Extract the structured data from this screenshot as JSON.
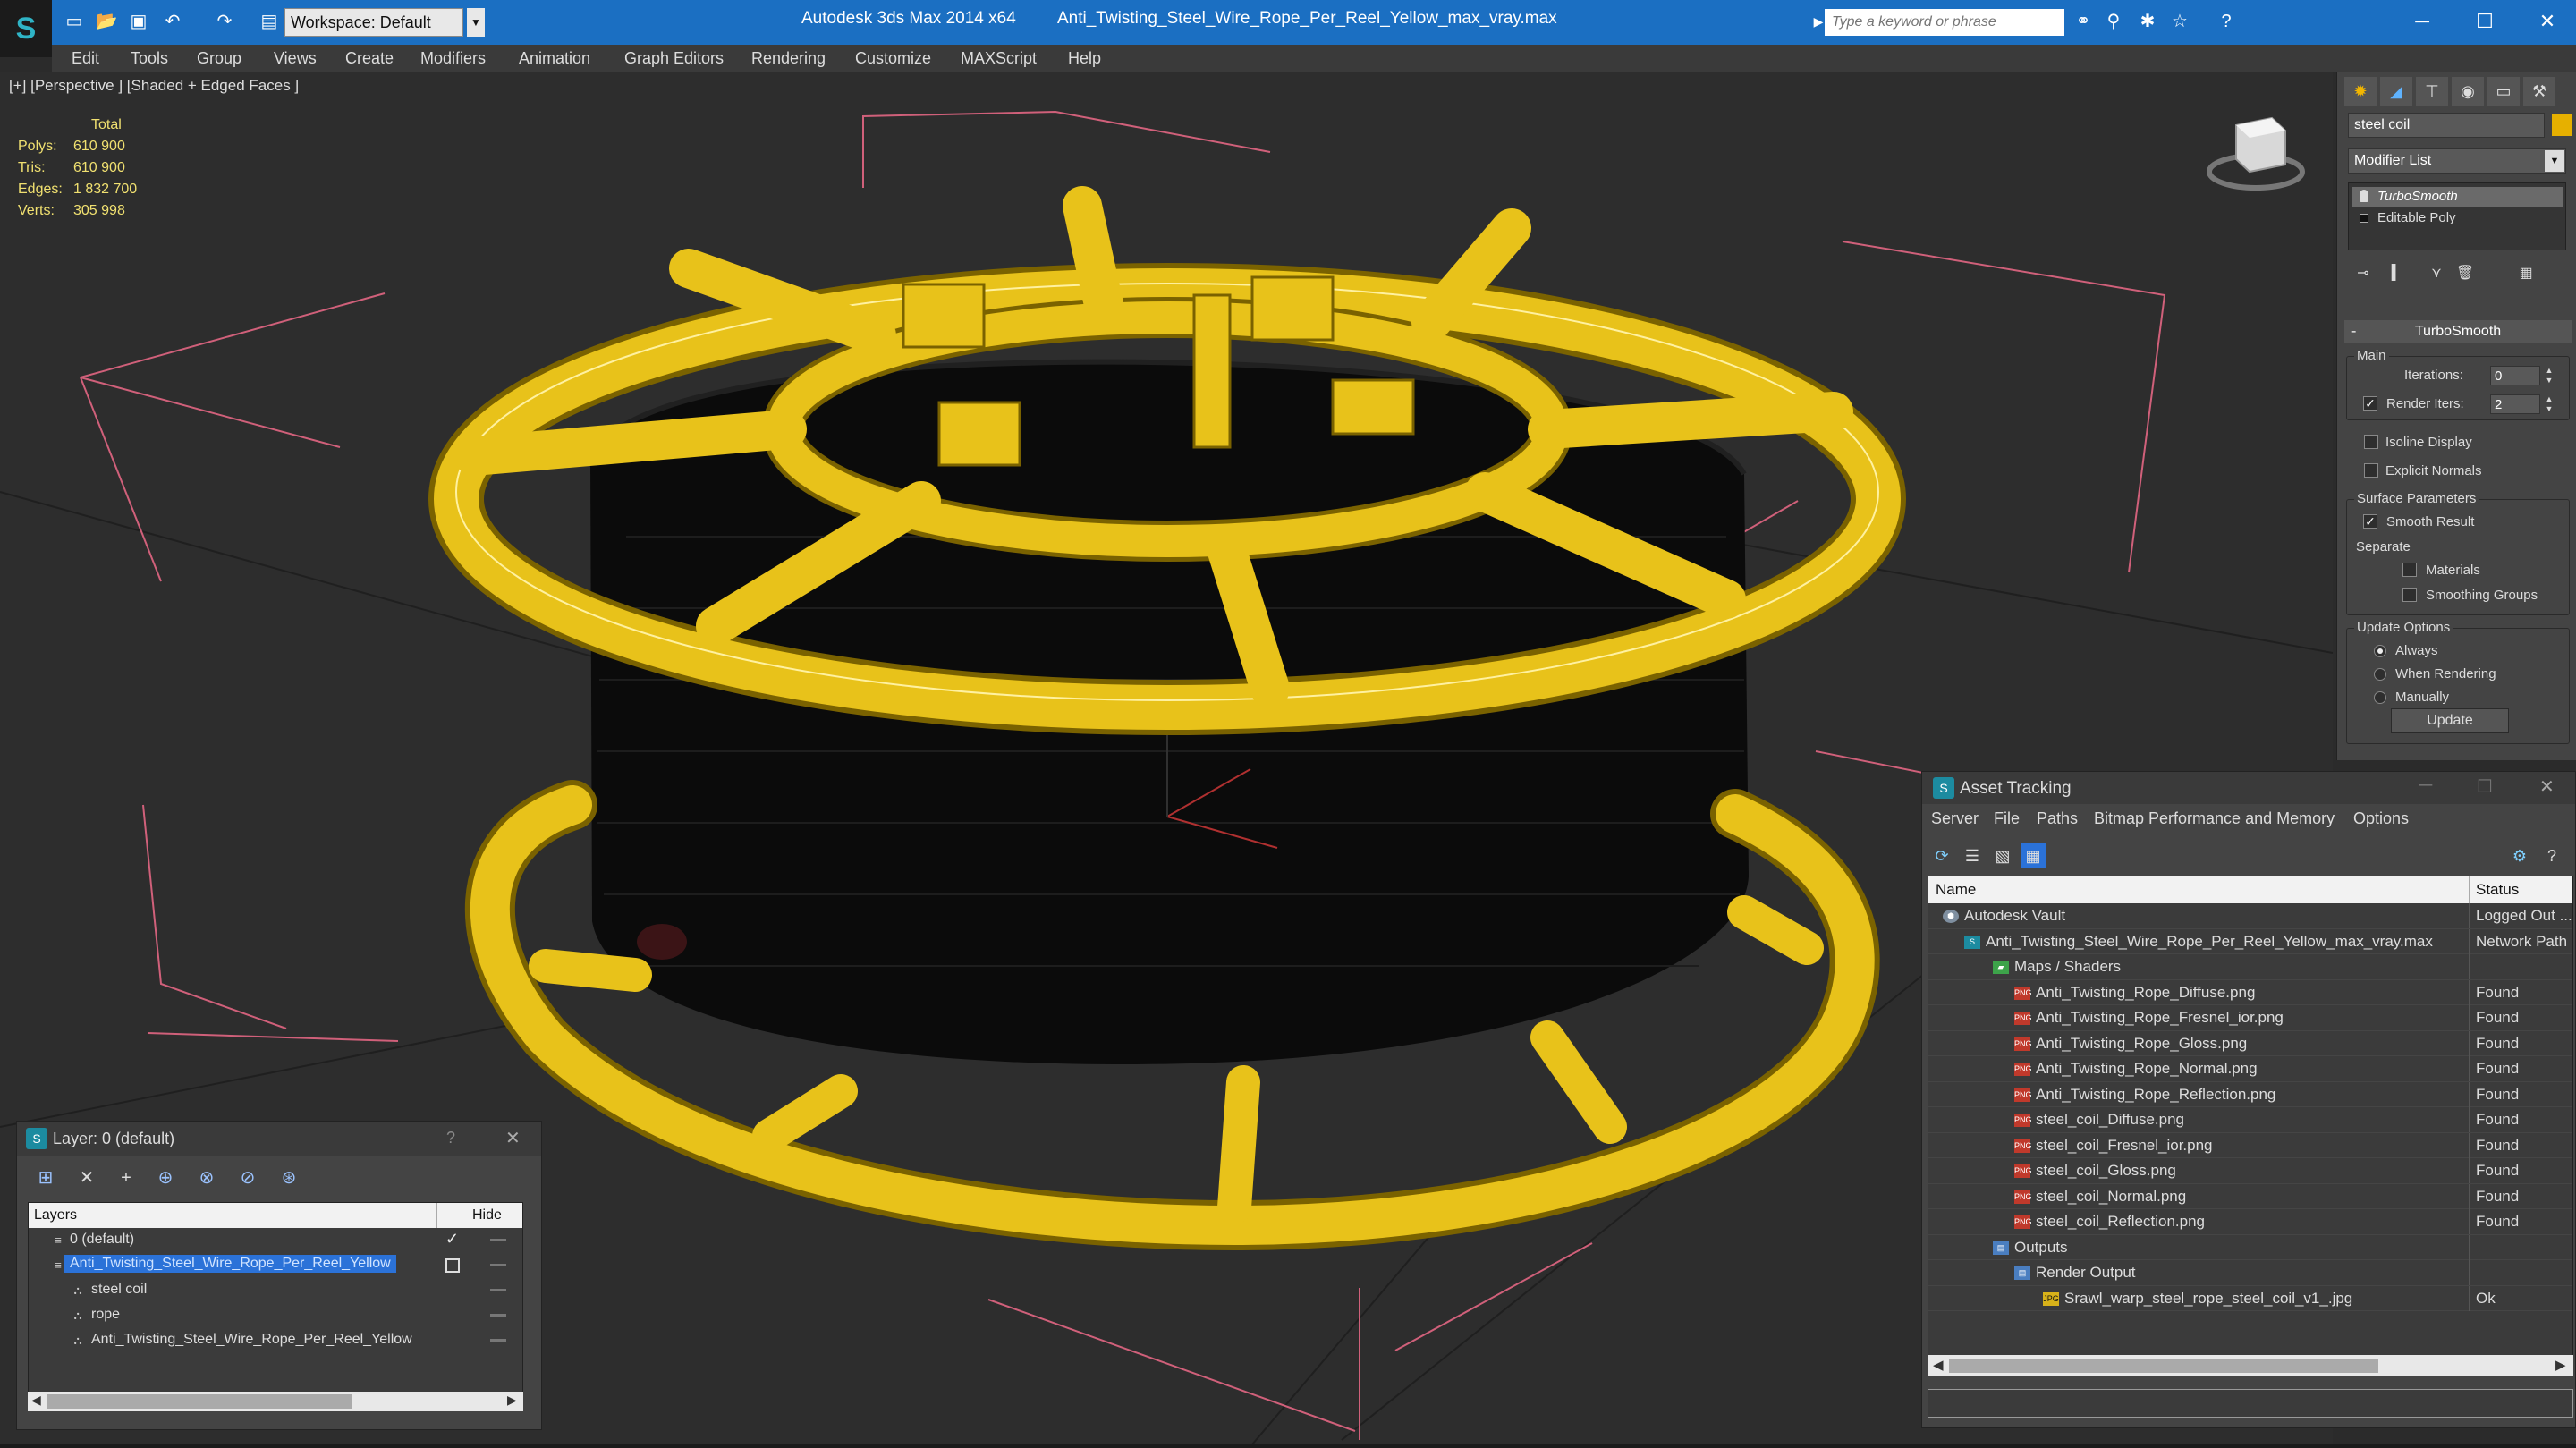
{
  "app": {
    "title": "Autodesk 3ds Max  2014 x64",
    "file": "Anti_Twisting_Steel_Wire_Rope_Per_Reel_Yellow_max_vray.max",
    "workspace": "Workspace: Default",
    "search_placeholder": "Type a keyword or phrase"
  },
  "menu": [
    "Edit",
    "Tools",
    "Group",
    "Views",
    "Create",
    "Modifiers",
    "Animation",
    "Graph Editors",
    "Rendering",
    "Customize",
    "MAXScript",
    "Help"
  ],
  "viewport": {
    "label": "[+] [Perspective ] [Shaded + Edged Faces ]",
    "stats": {
      "header": "Total",
      "rows": [
        {
          "k": "Polys:",
          "v": "610 900"
        },
        {
          "k": "Tris:",
          "v": "610 900"
        },
        {
          "k": "Edges:",
          "v": "1 832 700"
        },
        {
          "k": "Verts:",
          "v": "305 998"
        }
      ]
    },
    "reel_color": "#e8c21a",
    "bbox_color": "#d0607a"
  },
  "command_panel": {
    "object_name": "steel coil",
    "object_color": "#e6b000",
    "modifier_list": "Modifier List",
    "stack": [
      "TurboSmooth",
      "Editable Poly"
    ],
    "rollout": "TurboSmooth",
    "main_group": "Main",
    "iterations_label": "Iterations:",
    "iterations": "0",
    "render_iters_label": "Render Iters:",
    "render_iters": "2",
    "isoline": "Isoline Display",
    "explicit_normals": "Explicit Normals",
    "surface_group": "Surface Parameters",
    "smooth_result": "Smooth Result",
    "separate": "Separate",
    "materials": "Materials",
    "smoothing_groups": "Smoothing Groups",
    "update_group": "Update Options",
    "always": "Always",
    "when_rendering": "When Rendering",
    "manually": "Manually",
    "update_button": "Update"
  },
  "layer_window": {
    "title": "Layer: 0 (default)",
    "help": "?",
    "col_layers": "Layers",
    "col_hide": "Hide",
    "rows": [
      {
        "name": "0 (default)"
      },
      {
        "name": "Anti_Twisting_Steel_Wire_Rope_Per_Reel_Yellow"
      },
      {
        "name": "steel coil"
      },
      {
        "name": "rope"
      },
      {
        "name": "Anti_Twisting_Steel_Wire_Rope_Per_Reel_Yellow"
      }
    ]
  },
  "asset_window": {
    "title": "Asset Tracking",
    "menu": [
      "Server",
      "File",
      "Paths",
      "Bitmap Performance and Memory",
      "Options"
    ],
    "col_name": "Name",
    "col_status": "Status",
    "rows": [
      {
        "name": "Autodesk Vault",
        "status": "Logged Out ...",
        "icon": "vault"
      },
      {
        "name": "Anti_Twisting_Steel_Wire_Rope_Per_Reel_Yellow_max_vray.max",
        "status": "Network Path",
        "icon": "max"
      },
      {
        "name": "Maps / Shaders",
        "status": "",
        "icon": "folder"
      },
      {
        "name": "Anti_Twisting_Rope_Diffuse.png",
        "status": "Found",
        "icon": "png"
      },
      {
        "name": "Anti_Twisting_Rope_Fresnel_ior.png",
        "status": "Found",
        "icon": "png"
      },
      {
        "name": "Anti_Twisting_Rope_Gloss.png",
        "status": "Found",
        "icon": "png"
      },
      {
        "name": "Anti_Twisting_Rope_Normal.png",
        "status": "Found",
        "icon": "png"
      },
      {
        "name": "Anti_Twisting_Rope_Reflection.png",
        "status": "Found",
        "icon": "png"
      },
      {
        "name": "steel_coil_Diffuse.png",
        "status": "Found",
        "icon": "png"
      },
      {
        "name": "steel_coil_Fresnel_ior.png",
        "status": "Found",
        "icon": "png"
      },
      {
        "name": "steel_coil_Gloss.png",
        "status": "Found",
        "icon": "png"
      },
      {
        "name": "steel_coil_Normal.png",
        "status": "Found",
        "icon": "png"
      },
      {
        "name": "steel_coil_Reflection.png",
        "status": "Found",
        "icon": "png"
      },
      {
        "name": "Outputs",
        "status": "",
        "icon": "out"
      },
      {
        "name": "Render Output",
        "status": "",
        "icon": "out"
      },
      {
        "name": "Srawl_warp_steel_rope_steel_coil_v1_.jpg",
        "status": "Ok",
        "icon": "jpg"
      }
    ]
  }
}
